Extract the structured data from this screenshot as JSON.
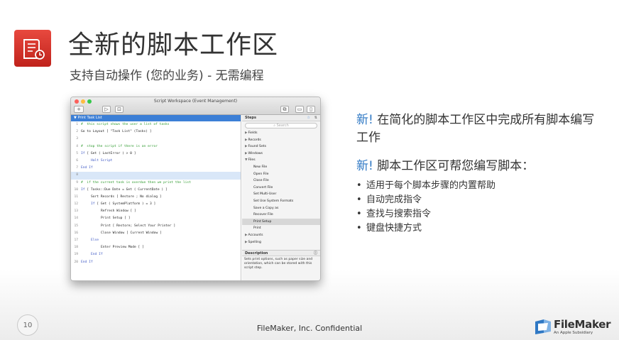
{
  "slide": {
    "title": "全新的脚本工作区",
    "subtitle": "支持自动操作 (您的业务) - 无需编程",
    "page_number": "10",
    "footer": "FileMaker, Inc. Confidential",
    "brand": {
      "name": "FileMaker",
      "tagline": "An Apple Subsidiary"
    }
  },
  "points": {
    "new_label": "新!",
    "point1_text": "在简化的脚本工作区中完成所有脚本编写工作",
    "point2_text": "脚本工作区可帮您编写脚本：",
    "bullets": [
      "适用于每个脚本步骤的内置帮助",
      "自动完成指令",
      "查找与搜索指令",
      "键盘快捷方式"
    ]
  },
  "window": {
    "title": "Script Workspace (Event Management)",
    "script_tab": "Print Task List",
    "lines": [
      {
        "n": "1",
        "indent": 0,
        "kind": "comment",
        "text": "#  this script shows the user a list of tasks"
      },
      {
        "n": "2",
        "indent": 0,
        "kind": "plain",
        "text": "Go to Layout [ \"Task List\" (Tasks) ]"
      },
      {
        "n": "3",
        "indent": 0,
        "kind": "plain",
        "text": ""
      },
      {
        "n": "4",
        "indent": 0,
        "kind": "comment",
        "text": "#  stop the script if there is an error"
      },
      {
        "n": "5",
        "indent": 0,
        "kind": "kw",
        "kw": "If",
        "text": " [ Get ( LastError ) > 0 ]"
      },
      {
        "n": "6",
        "indent": 1,
        "kind": "kw",
        "kw": "Halt Script",
        "text": ""
      },
      {
        "n": "7",
        "indent": 0,
        "kind": "kw",
        "kw": "End If",
        "text": ""
      },
      {
        "n": "8",
        "indent": 0,
        "kind": "plain",
        "text": "",
        "selected": true
      },
      {
        "n": "9",
        "indent": 0,
        "kind": "comment",
        "text": "#  if the current task is overdue then we print the list"
      },
      {
        "n": "10",
        "indent": 0,
        "kind": "kw",
        "kw": "If",
        "text": " [ Tasks::Due Date = Get ( CurrentDate ) ]"
      },
      {
        "n": "11",
        "indent": 1,
        "kind": "plain",
        "text": "Sort Records [ Restore ; No dialog ]"
      },
      {
        "n": "12",
        "indent": 1,
        "kind": "kw",
        "kw": "If",
        "text": " [ Get ( SystemPlatform ) = 3 ]"
      },
      {
        "n": "13",
        "indent": 2,
        "kind": "plain",
        "text": "Refresh Window [ ]"
      },
      {
        "n": "14",
        "indent": 2,
        "kind": "plain",
        "text": "Print Setup [ ]"
      },
      {
        "n": "15",
        "indent": 2,
        "kind": "plain",
        "text": "Print [ Restore; Select Your Printer ]"
      },
      {
        "n": "16",
        "indent": 2,
        "kind": "plain",
        "text": "Close Window [ Current Window ]"
      },
      {
        "n": "17",
        "indent": 1,
        "kind": "kw",
        "kw": "Else",
        "text": ""
      },
      {
        "n": "18",
        "indent": 2,
        "kind": "plain",
        "text": "Enter Preview Mode [ ]"
      },
      {
        "n": "19",
        "indent": 1,
        "kind": "kw",
        "kw": "End If",
        "text": ""
      },
      {
        "n": "20",
        "indent": 0,
        "kind": "kw",
        "kw": "End If",
        "text": ""
      }
    ],
    "steps_header": "Steps",
    "search_placeholder": "Search",
    "steps": [
      {
        "label": "Fields",
        "type": "group",
        "arrow": "▶"
      },
      {
        "label": "Records",
        "type": "group",
        "arrow": "▶"
      },
      {
        "label": "Found Sets",
        "type": "group",
        "arrow": "▶"
      },
      {
        "label": "Windows",
        "type": "group",
        "arrow": "▶"
      },
      {
        "label": "Files",
        "type": "group",
        "arrow": "▼"
      },
      {
        "label": "New File",
        "type": "sub"
      },
      {
        "label": "Open File",
        "type": "sub"
      },
      {
        "label": "Close File",
        "type": "sub"
      },
      {
        "label": "Convert File",
        "type": "sub"
      },
      {
        "label": "Set Multi-User",
        "type": "sub"
      },
      {
        "label": "Set Use System Formats",
        "type": "sub"
      },
      {
        "label": "Save a Copy as",
        "type": "sub"
      },
      {
        "label": "Recover File",
        "type": "sub"
      },
      {
        "label": "Print Setup",
        "type": "sub",
        "highlight": true
      },
      {
        "label": "Print",
        "type": "sub"
      },
      {
        "label": "Accounts",
        "type": "group",
        "arrow": "▶"
      },
      {
        "label": "Spelling",
        "type": "group",
        "arrow": "▶"
      }
    ],
    "description_header": "Description",
    "description_text": "Sets print options, such as paper size and orientation, which can be stored with this script step."
  },
  "colors": {
    "accent_blue": "#2f78c4",
    "logo_red": "#d1322a",
    "selection_blue": "#3c7fd6"
  }
}
